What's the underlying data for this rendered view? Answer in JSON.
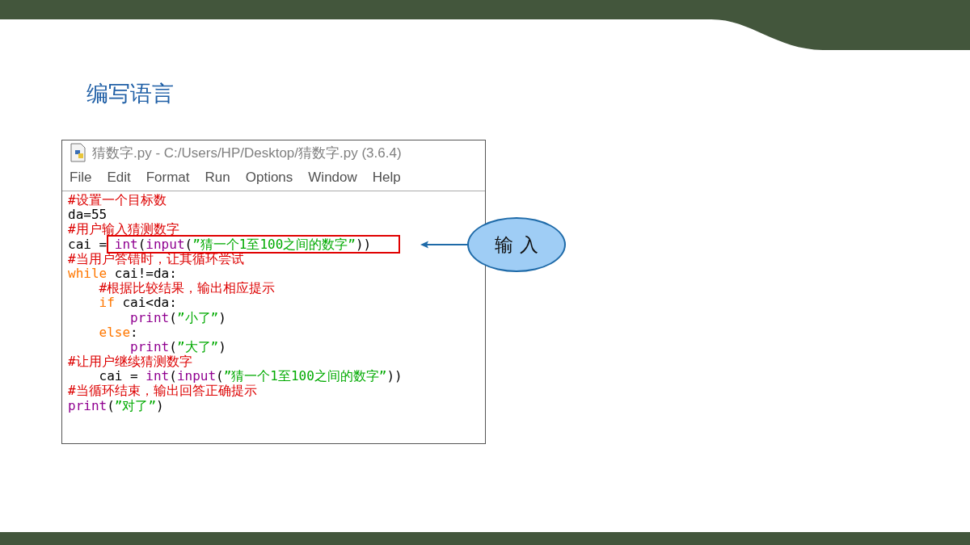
{
  "heading": "编写语言",
  "window": {
    "title": "猜数字.py - C:/Users/HP/Desktop/猜数字.py (3.6.4)",
    "menu": [
      "File",
      "Edit",
      "Format",
      "Run",
      "Options",
      "Window",
      "Help"
    ],
    "code_lines": [
      {
        "tokens": [
          {
            "kind": "comment",
            "text": "#设置一个目标数"
          }
        ]
      },
      {
        "tokens": [
          {
            "kind": "plain",
            "text": "da=55"
          }
        ]
      },
      {
        "tokens": [
          {
            "kind": "comment",
            "text": "#用户输入猜测数字"
          }
        ]
      },
      {
        "tokens": [
          {
            "kind": "plain",
            "text": "cai = "
          },
          {
            "kind": "box",
            "tokens": [
              {
                "kind": "builtin",
                "text": "int"
              },
              {
                "kind": "plain",
                "text": "("
              },
              {
                "kind": "builtin",
                "text": "input"
              },
              {
                "kind": "plain",
                "text": "("
              },
              {
                "kind": "string",
                "text": "”猜一个1至100之间的数字”"
              },
              {
                "kind": "plain",
                "text": "))"
              }
            ]
          }
        ]
      },
      {
        "tokens": [
          {
            "kind": "comment",
            "text": "#当用户答错时，让其循环尝试"
          }
        ]
      },
      {
        "tokens": [
          {
            "kind": "keyword",
            "text": "while"
          },
          {
            "kind": "plain",
            "text": " cai!=da:"
          }
        ]
      },
      {
        "tokens": [
          {
            "kind": "comment",
            "text": "    #根据比较结果，输出相应提示"
          }
        ]
      },
      {
        "tokens": [
          {
            "kind": "keyword",
            "text": "    if"
          },
          {
            "kind": "plain",
            "text": " cai<da:"
          }
        ]
      },
      {
        "tokens": [
          {
            "kind": "builtin",
            "text": "        print"
          },
          {
            "kind": "plain",
            "text": "("
          },
          {
            "kind": "string",
            "text": "”小了”"
          },
          {
            "kind": "plain",
            "text": ")"
          }
        ]
      },
      {
        "tokens": [
          {
            "kind": "keyword",
            "text": "    else"
          },
          {
            "kind": "plain",
            "text": ":"
          }
        ]
      },
      {
        "tokens": [
          {
            "kind": "builtin",
            "text": "        print"
          },
          {
            "kind": "plain",
            "text": "("
          },
          {
            "kind": "string",
            "text": "”大了”"
          },
          {
            "kind": "plain",
            "text": ")"
          }
        ]
      },
      {
        "tokens": [
          {
            "kind": "comment",
            "text": "#让用户继续猜测数字"
          }
        ]
      },
      {
        "tokens": [
          {
            "kind": "plain",
            "text": "    cai = "
          },
          {
            "kind": "builtin",
            "text": "int"
          },
          {
            "kind": "plain",
            "text": "("
          },
          {
            "kind": "builtin",
            "text": "input"
          },
          {
            "kind": "plain",
            "text": "("
          },
          {
            "kind": "string",
            "text": "”猜一个1至100之间的数字”"
          },
          {
            "kind": "plain",
            "text": "))"
          }
        ]
      },
      {
        "tokens": [
          {
            "kind": "comment",
            "text": "#当循环结束，输出回答正确提示"
          }
        ]
      },
      {
        "tokens": [
          {
            "kind": "builtin",
            "text": "print"
          },
          {
            "kind": "plain",
            "text": "("
          },
          {
            "kind": "string",
            "text": "”对了”"
          },
          {
            "kind": "plain",
            "text": ")"
          }
        ]
      }
    ]
  },
  "callout": {
    "label": "输 入"
  }
}
